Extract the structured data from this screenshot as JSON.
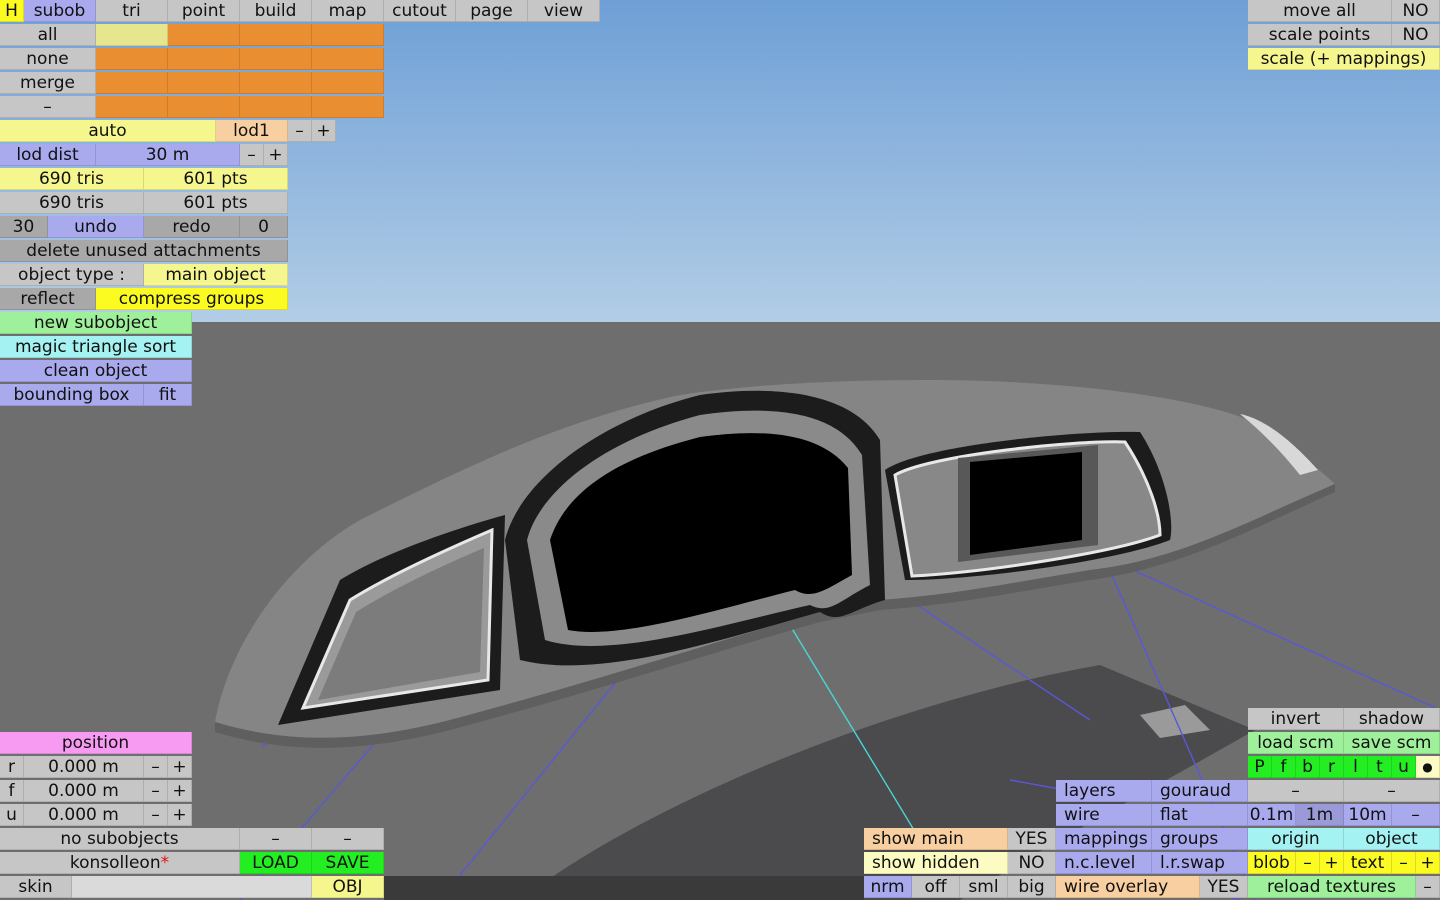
{
  "top_menu": {
    "h": "H",
    "tabs": [
      "subob",
      "tri",
      "point",
      "build",
      "map",
      "cutout",
      "page",
      "view"
    ]
  },
  "selection": {
    "all": "all",
    "none": "none",
    "merge": "merge",
    "minus": "–"
  },
  "lod": {
    "auto": "auto",
    "level": "lod1",
    "minus": "–",
    "plus": "+",
    "dist_label": "lod dist",
    "dist_value": "30 m"
  },
  "stats": {
    "tris_sel": "690 tris",
    "pts_sel": "601 pts",
    "tris_total": "690 tris",
    "pts_total": "601 pts"
  },
  "history": {
    "count": "30",
    "undo": "undo",
    "redo": "redo",
    "redo_count": "0"
  },
  "actions": {
    "delete_unused": "delete unused attachments",
    "object_type_label": "object type :",
    "object_type_value": "main object",
    "reflect": "reflect",
    "compress_groups": "compress groups",
    "new_subobject": "new subobject",
    "magic_sort": "magic triangle sort",
    "clean_object": "clean object",
    "bounding_box": "bounding box",
    "fit": "fit"
  },
  "top_right": {
    "move_all": "move all",
    "move_all_value": "NO",
    "scale_points": "scale points",
    "scale_points_value": "NO",
    "scale_mappings": "scale (+ mappings)"
  },
  "position": {
    "title": "position",
    "rows": [
      {
        "axis": "r",
        "value": "0.000 m"
      },
      {
        "axis": "f",
        "value": "0.000 m"
      },
      {
        "axis": "u",
        "value": "0.000 m"
      }
    ],
    "minus": "–",
    "plus": "+"
  },
  "bottom_left": {
    "no_subobjects": "no subobjects",
    "dash": "–",
    "object_name": "konsolleon",
    "unsaved_mark": "*",
    "load": "LOAD",
    "save": "SAVE",
    "skin": "skin",
    "obj": "OBJ"
  },
  "show": {
    "show_main": "show main",
    "show_main_value": "YES",
    "show_hidden": "show hidden",
    "show_hidden_value": "NO",
    "nrm": "nrm",
    "off": "off",
    "sml": "sml",
    "big": "big"
  },
  "render": {
    "layers": "layers",
    "gouraud": "gouraud",
    "wire": "wire",
    "flat": "flat",
    "mappings": "mappings",
    "groups": "groups",
    "nc_level": "n.c.level",
    "lr_swap": "l.r.swap",
    "wire_overlay": "wire overlay",
    "wire_overlay_value": "YES"
  },
  "bottom_right": {
    "invert": "invert",
    "shadow": "shadow",
    "load_scm": "load scm",
    "save_scm": "save scm",
    "view_keys": [
      "P",
      "f",
      "b",
      "r",
      "l",
      "t",
      "u",
      "●"
    ],
    "dash": "–",
    "grid": [
      "0.1m",
      "1m",
      "10m",
      "–"
    ],
    "origin": "origin",
    "object": "object",
    "blob": "blob",
    "text": "text",
    "minus": "–",
    "plus": "+",
    "reload_textures": "reload textures"
  }
}
